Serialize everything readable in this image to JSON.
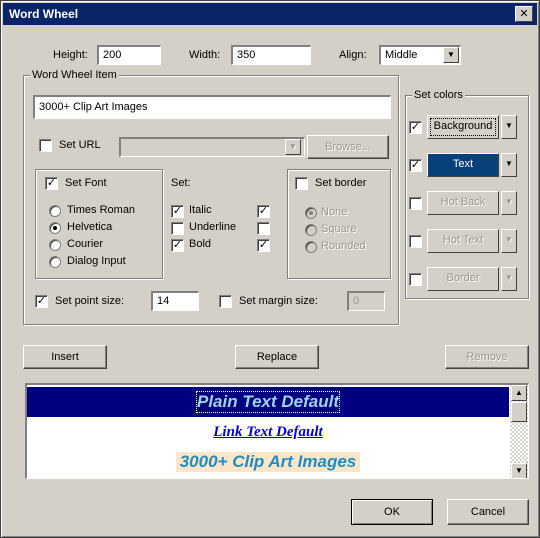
{
  "window": {
    "title": "Word Wheel",
    "close_glyph": "✕"
  },
  "dimensions": {
    "height_label": "Height:",
    "height_value": "200",
    "width_label": "Width:",
    "width_value": "350",
    "align_label": "Align:",
    "align_value": "Middle"
  },
  "item_group": {
    "title": "Word Wheel Item",
    "item_text": "3000+ Clip Art Images",
    "set_url_label": "Set URL",
    "url_value": "",
    "browse_label": "Browse..."
  },
  "font_group": {
    "set_font_label": "Set Font",
    "fonts": [
      {
        "label": "Times Roman",
        "selected": false
      },
      {
        "label": "Helvetica",
        "selected": true
      },
      {
        "label": "Courier",
        "selected": false
      },
      {
        "label": "Dialog Input",
        "selected": false
      }
    ]
  },
  "style_group": {
    "title": "Set:",
    "styles": [
      {
        "label": "Italic",
        "checked": true,
        "set_checked": true
      },
      {
        "label": "Underline",
        "checked": false,
        "set_checked": false
      },
      {
        "label": "Bold",
        "checked": true,
        "set_checked": true
      }
    ]
  },
  "border_group": {
    "set_border_label": "Set border",
    "options": [
      {
        "label": "None",
        "selected": true
      },
      {
        "label": "Square",
        "selected": false
      },
      {
        "label": "Rounded",
        "selected": false
      }
    ]
  },
  "size_row": {
    "point_size_label": "Set point size:",
    "point_size_value": "14",
    "margin_size_label": "Set margin size:",
    "margin_size_value": "0"
  },
  "colors_group": {
    "title": "Set colors",
    "items": [
      {
        "label": "Background",
        "checked": true,
        "enabled": true,
        "active": false
      },
      {
        "label": "Text",
        "checked": true,
        "enabled": true,
        "active": true
      },
      {
        "label": "Hot Back",
        "checked": false,
        "enabled": false,
        "active": false
      },
      {
        "label": "Hot Text",
        "checked": false,
        "enabled": false,
        "active": false
      },
      {
        "label": "Border",
        "checked": false,
        "enabled": false,
        "active": false
      }
    ]
  },
  "actions": {
    "insert_label": "Insert",
    "replace_label": "Replace",
    "remove_label": "Remove"
  },
  "preview": {
    "rows": [
      {
        "text": "Plain Text Default",
        "bg": "#000080",
        "color": "#9fd3e8"
      },
      {
        "text": "Link Text Default",
        "bg": "#ffffff",
        "color": "#0000cc"
      },
      {
        "text": "3000+ Clip Art Images",
        "bg": "#ffffff",
        "color": "#1f8cc6"
      }
    ]
  },
  "footer": {
    "ok_label": "OK",
    "cancel_label": "Cancel"
  },
  "colors": {
    "title_bar": "#0a246a",
    "dialog_bg": "#d4d0c8",
    "text_active": "#08407c"
  }
}
